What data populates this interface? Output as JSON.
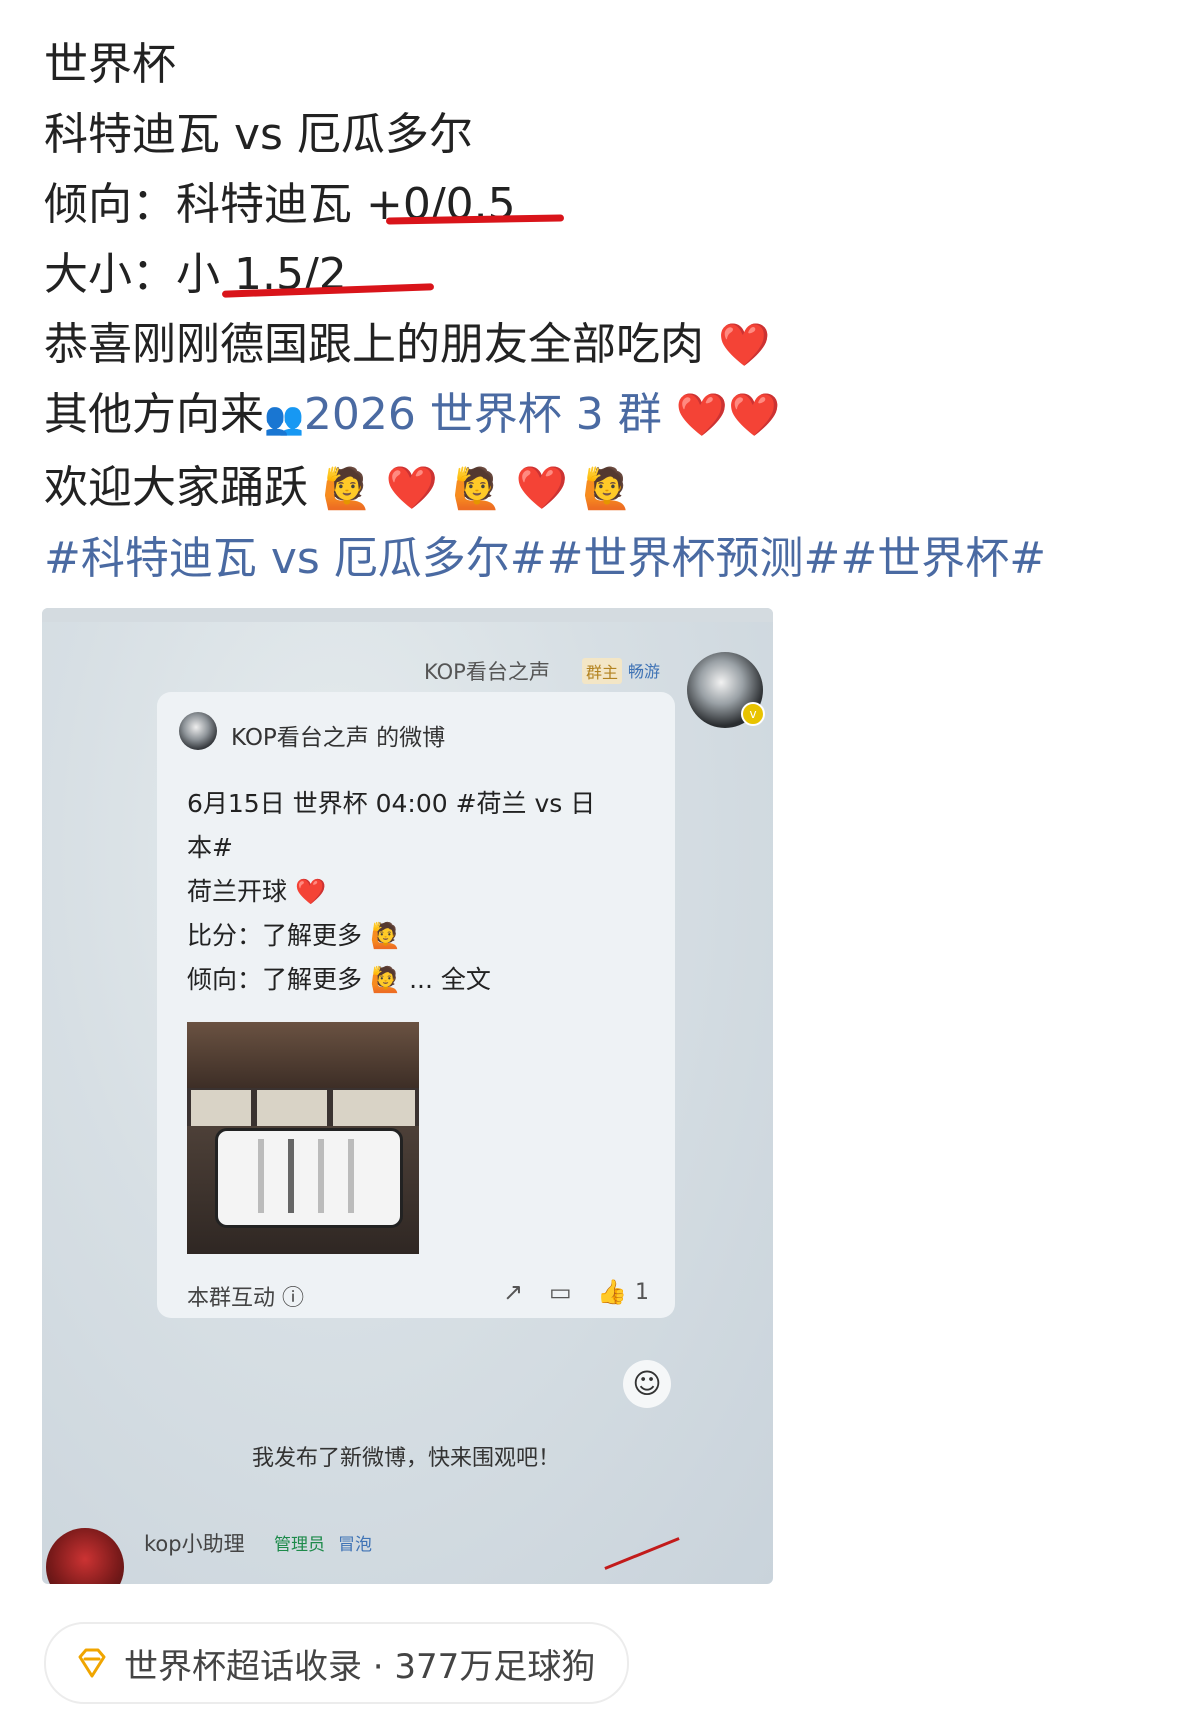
{
  "post": {
    "line1": "世界杯",
    "line2": "科特迪瓦 vs 厄瓜多尔",
    "line3": "倾向：科特迪瓦 +0/0.5",
    "line4": "大小：小 1.5/2",
    "line5": "恭喜刚刚德国跟上的朋友全部吃肉",
    "line6_prefix": "其他方向来",
    "line6_link": "2026 世界杯 3 群",
    "line7": "欢迎大家踊跃",
    "hashtags": "#科特迪瓦 vs 厄瓜多尔##世界杯预测##世界杯#",
    "heart_emoji": "❤️",
    "cheer_emoji": "🙋",
    "group_icon": "👥"
  },
  "photo": {
    "group_sender": "KOP看台之声",
    "owner_badge": "群主",
    "vip_badge": "畅游",
    "card_title": "KOP看台之声 的微博",
    "card_line1": "6月15日 世界杯 04:00 #荷兰 vs 日",
    "card_line2": "本#",
    "card_line3": "荷兰开球",
    "card_line4": "比分：了解更多",
    "card_line5": "倾向：了解更多",
    "card_more": "... 全文",
    "card_footer": "本群互动 ⓘ",
    "like_count": "1",
    "notice": "我发布了新微博，快来围观吧！",
    "assistant_name": "kop小助理",
    "admin_badge": "管理员",
    "bubble_badge": "冒泡"
  },
  "topic": {
    "text": "世界杯超话收录 · 377万足球狗",
    "accent": "#f0a500"
  }
}
